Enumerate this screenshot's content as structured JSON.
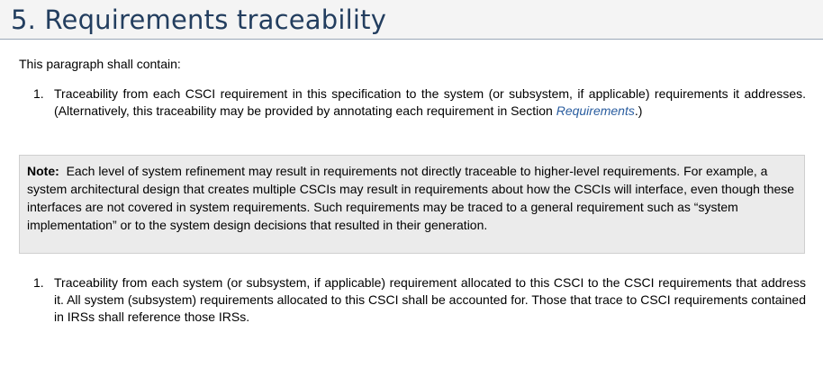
{
  "header": {
    "title": "5. Requirements traceability"
  },
  "intro": "This paragraph shall contain:",
  "item1": {
    "number": "1.",
    "text_before": "Traceability from each CSCI requirement in this specification to the system (or subsystem, if applicable) requirements it addresses. (Alternatively, this traceability may be provided by annotating each requirement in Section ",
    "link": "Requirements",
    "text_after": ".)"
  },
  "note": {
    "label": "Note:",
    "text": "Each level of system refinement may result in requirements not directly traceable to higher-level requirements. For example, a system architectural design that creates multiple CSCIs may result in requirements about how the CSCIs will interface, even though these interfaces are not covered in system requirements. Such requirements may be traced to a general requirement such as “system implementation” or to the system design decisions that resulted in their generation."
  },
  "item2": {
    "number": "1.",
    "text": "Traceability from each system (or subsystem, if applicable) requirement allocated to this CSCI to the CSCI requirements that address it. All system (subsystem) requirements allocated to this CSCI shall be accounted for. Those that trace to CSCI requirements contained in IRSs shall reference those IRSs."
  },
  "colors": {
    "title": "#233e5f",
    "link": "#2a5d9f",
    "note_background": "#ebebeb"
  }
}
